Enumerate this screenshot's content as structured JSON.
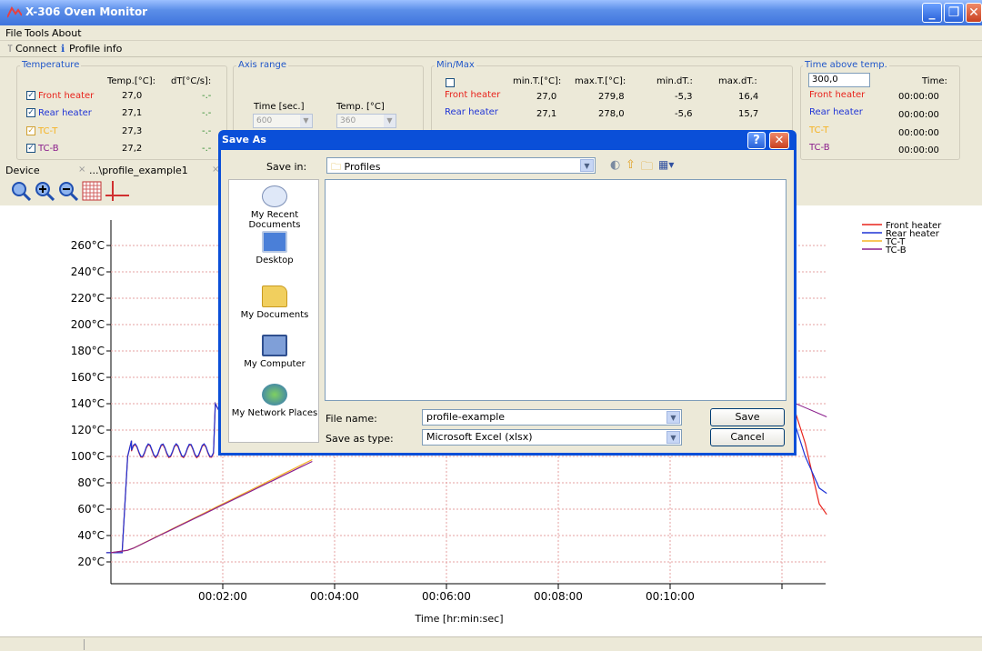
{
  "window": {
    "title": "X-306 Oven Monitor"
  },
  "menu": [
    "File",
    "Tools",
    "About"
  ],
  "toolbar": {
    "connect": "Connect",
    "profile_info": "Profile info"
  },
  "temperature": {
    "title": "Temperature",
    "col_temp": "Temp.[°C]:",
    "col_dt": "dT[°C/s]:",
    "rows": [
      {
        "name": "Front heater",
        "temp": "27,0",
        "dt": "-.-",
        "color": "#e8231c"
      },
      {
        "name": "Rear heater",
        "temp": "27,1",
        "dt": "-.-",
        "color": "#1f34d6"
      },
      {
        "name": "TC-T",
        "temp": "27,3",
        "dt": "-.-",
        "color": "#f5b324"
      },
      {
        "name": "TC-B",
        "temp": "27,2",
        "dt": "-.-",
        "color": "#8b1e8c"
      }
    ]
  },
  "axis_range": {
    "title": "Axis range",
    "time_label": "Time [sec.]",
    "temp_label": "Temp. [°C]",
    "time_value": "600",
    "temp_value": "360"
  },
  "minmax": {
    "title": "Min/Max",
    "headers": [
      "min.T.[°C]:",
      "max.T.[°C]:",
      "min.dT.:",
      "max.dT.:"
    ],
    "rows": [
      {
        "name": "Front heater",
        "vals": [
          "27,0",
          "279,8",
          "-5,3",
          "16,4"
        ]
      },
      {
        "name": "Rear heater",
        "vals": [
          "27,1",
          "278,0",
          "-5,6",
          "15,7"
        ]
      }
    ]
  },
  "time_above": {
    "title": "Time above temp.",
    "value": "300,0",
    "time_header": "Time:",
    "rows": [
      {
        "name": "Front heater",
        "time": "00:00:00",
        "color": "#e8231c"
      },
      {
        "name": "Rear heater",
        "time": "00:00:00",
        "color": "#1f34d6"
      },
      {
        "name": "TC-T",
        "time": "00:00:00",
        "color": "#f5b324"
      },
      {
        "name": "TC-B",
        "time": "00:00:00",
        "color": "#8b1e8c"
      }
    ]
  },
  "tabs": {
    "device": "Device",
    "profile": "...\\profile_example1"
  },
  "chart": {
    "y_ticks": [
      "260°C",
      "240°C",
      "220°C",
      "200°C",
      "180°C",
      "160°C",
      "140°C",
      "120°C",
      "100°C",
      "80°C",
      "60°C",
      "40°C",
      "20°C"
    ],
    "x_ticks": [
      "00:02:00",
      "00:04:00",
      "00:06:00",
      "00:08:00",
      "00:10:00"
    ],
    "xlabel": "Time [hr:min:sec]",
    "legend": [
      "Front heater",
      "Rear heater",
      "TC-T",
      "TC-B"
    ]
  },
  "dialog": {
    "title": "Save As",
    "save_in_label": "Save in:",
    "save_in_value": "Profiles",
    "places": [
      "My Recent Documents",
      "Desktop",
      "My Documents",
      "My Computer",
      "My Network Places"
    ],
    "file_name_label": "File name:",
    "file_name_value": "profile-example",
    "save_type_label": "Save as type:",
    "save_type_value": "Microsoft Excel (xlsx)",
    "save_button": "Save",
    "cancel_button": "Cancel"
  }
}
